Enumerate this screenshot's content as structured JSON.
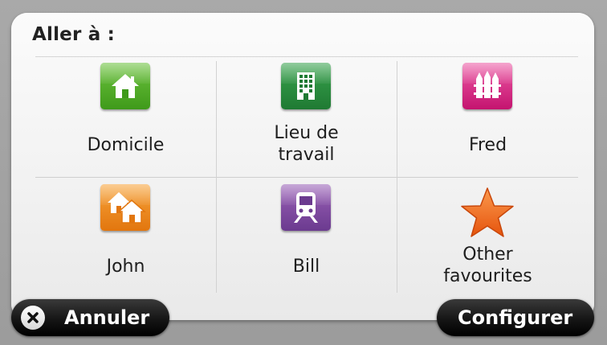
{
  "title": "Aller à :",
  "favourites": [
    {
      "label": "Domicile",
      "icon": "home-icon",
      "color": "#4fae2a"
    },
    {
      "label": "Lieu de travail",
      "icon": "office-building-icon",
      "color": "#2a8d3f"
    },
    {
      "label": "Fred",
      "icon": "fence-icon",
      "color": "#d9318a"
    },
    {
      "label": "John",
      "icon": "houses-icon",
      "color": "#ee8b1f"
    },
    {
      "label": "Bill",
      "icon": "train-icon",
      "color": "#7f4aa2"
    },
    {
      "label": "Other favourites",
      "icon": "star-icon",
      "color": "#f26b1d"
    }
  ],
  "buttons": {
    "cancel_label": "Annuler",
    "configure_label": "Configurer"
  }
}
